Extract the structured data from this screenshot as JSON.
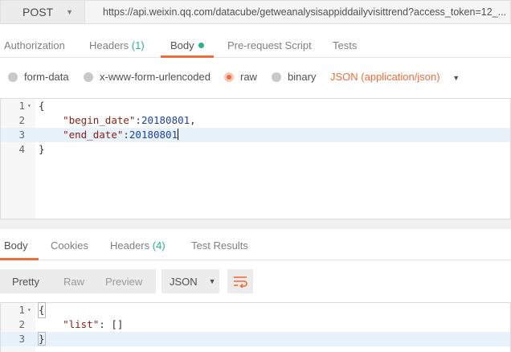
{
  "request": {
    "method": "POST",
    "url": "https://api.weixin.qq.com/datacube/getweanalysisappiddailyvisittrend?access_token=12_..."
  },
  "request_tabs": [
    {
      "label": "Authorization",
      "count": ""
    },
    {
      "label": "Headers",
      "count": "(1)"
    },
    {
      "label": "Body",
      "count": ""
    },
    {
      "label": "Pre-request Script",
      "count": ""
    },
    {
      "label": "Tests",
      "count": ""
    }
  ],
  "body_options": {
    "radios": [
      "form-data",
      "x-www-form-urlencoded",
      "raw",
      "binary"
    ],
    "selected": "raw",
    "content_type": "JSON (application/json)"
  },
  "request_editor": {
    "lines": [
      {
        "n": "1",
        "text": "{"
      },
      {
        "n": "2",
        "key": "\"begin_date\"",
        "sep": ":",
        "value": "20180801",
        "tail": ","
      },
      {
        "n": "3",
        "key": "\"end_date\"",
        "sep": ":",
        "value": "20180801",
        "tail": ""
      },
      {
        "n": "4",
        "text": "}"
      }
    ]
  },
  "response_tabs": [
    {
      "label": "Body",
      "count": ""
    },
    {
      "label": "Cookies",
      "count": ""
    },
    {
      "label": "Headers",
      "count": "(4)"
    },
    {
      "label": "Test Results",
      "count": ""
    }
  ],
  "response_toolbar": {
    "views": [
      "Pretty",
      "Raw",
      "Preview"
    ],
    "active_view": "Pretty",
    "format": "JSON",
    "wrap_icon": "wrap-lines-icon"
  },
  "response_editor": {
    "lines": [
      {
        "n": "1",
        "text": "{"
      },
      {
        "n": "2",
        "key": "\"list\"",
        "sep": ": ",
        "value": "[]"
      },
      {
        "n": "3",
        "text": "}"
      }
    ]
  },
  "colors": {
    "accent": "#f26b3a",
    "count_green": "#26b47f",
    "highlight": "#e8f2fb"
  }
}
